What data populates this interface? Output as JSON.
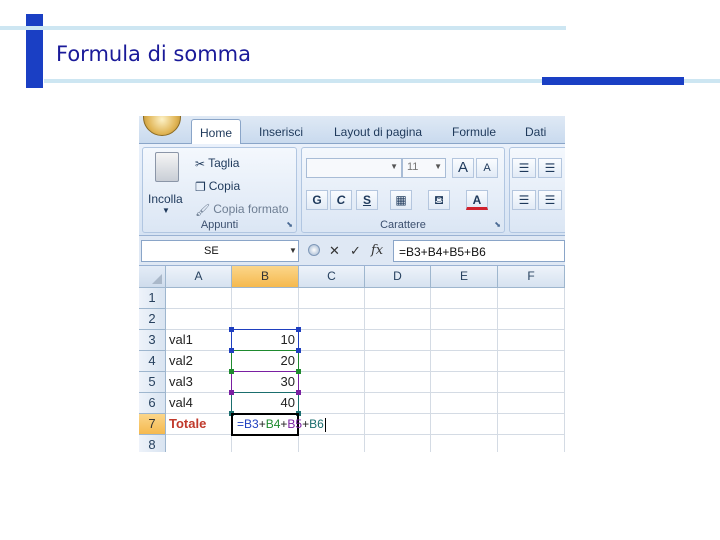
{
  "slide": {
    "title": "Formula di somma",
    "colors": {
      "title": "#1a1a99",
      "accent_bar": "#1a3fc4",
      "rule": "#cde6f2"
    }
  },
  "ribbon": {
    "tabs": [
      {
        "label": "Home",
        "active": true
      },
      {
        "label": "Inserisci"
      },
      {
        "label": "Layout di pagina"
      },
      {
        "label": "Formule"
      },
      {
        "label": "Dati"
      }
    ],
    "clipboard": {
      "paste_label": "Incolla",
      "cut_label": "Taglia",
      "copy_label": "Copia",
      "format_painter_label": "Copia formato",
      "group_label": "Appunti"
    },
    "font": {
      "font_size_value": "11",
      "bold_label": "G",
      "italic_label": "C",
      "underline_label": "S",
      "grow_label": "A",
      "shrink_label": "A",
      "font_color_label": "A",
      "group_label": "Carattere"
    }
  },
  "formula_bar": {
    "name_box_value": "SE",
    "cancel_symbol": "✕",
    "enter_symbol": "✓",
    "fx_symbol": "fx",
    "formula_value": "=B3+B4+B5+B6"
  },
  "sheet": {
    "columns": [
      "A",
      "B",
      "C",
      "D",
      "E",
      "F"
    ],
    "rows": [
      "1",
      "2",
      "3",
      "4",
      "5",
      "6",
      "7",
      "8"
    ],
    "selected_column": "B",
    "selected_row": "7",
    "cells": {
      "a3": "val1",
      "b3": "10",
      "a4": "val2",
      "b4": "20",
      "a5": "val3",
      "b5": "30",
      "a6": "val4",
      "b6": "40",
      "a7": "Totale"
    },
    "formula_parts": {
      "p1": "=B3",
      "plus1": "+",
      "p2": "B4",
      "plus2": "+",
      "p3": "B5",
      "plus3": "+",
      "p4": "B6"
    },
    "reference_colors": {
      "b3": "#1f3fbf",
      "b4": "#1e8a2e",
      "b5": "#7a1fa2",
      "b6": "#1a6e6e"
    }
  }
}
